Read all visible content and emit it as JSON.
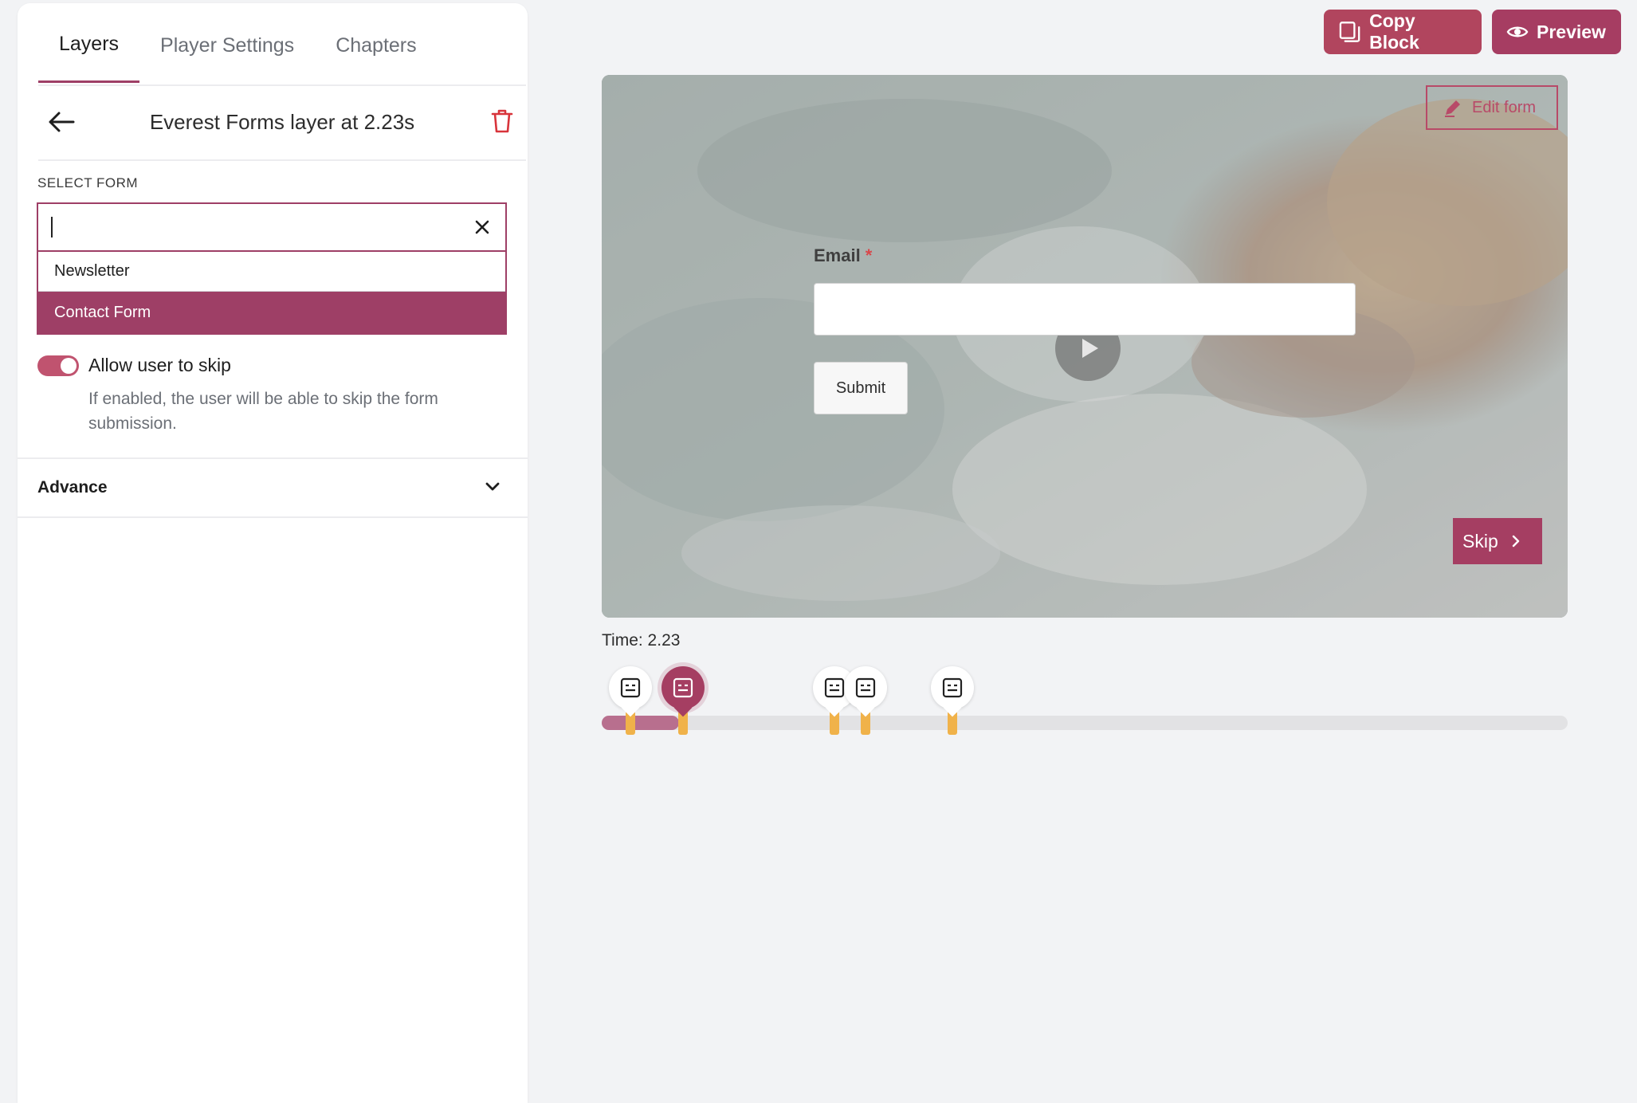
{
  "sidebar": {
    "tabs": [
      {
        "label": "Layers",
        "active": true
      },
      {
        "label": "Player Settings",
        "active": false
      },
      {
        "label": "Chapters",
        "active": false
      }
    ],
    "layer_title": "Everest Forms layer at 2.23s",
    "select_form": {
      "label": "SELECT FORM",
      "search_value": "",
      "options": [
        {
          "label": "Newsletter",
          "selected": false
        },
        {
          "label": "Contact Form",
          "selected": true
        }
      ]
    },
    "allow_skip": {
      "label": "Allow user to skip",
      "enabled": true,
      "help": "If enabled, the user will be able to skip the form submission."
    },
    "advance_label": "Advance"
  },
  "toolbar": {
    "copy_label": "Copy Block",
    "preview_label": "Preview"
  },
  "video": {
    "edit_form_label": "Edit form",
    "email_label": "Email",
    "required_mark": "*",
    "submit_label": "Submit",
    "skip_label": "Skip"
  },
  "timeline": {
    "time_text": "Time: 2.23",
    "progress_fraction": 0.08,
    "markers": [
      {
        "active": false
      },
      {
        "active": true
      },
      {
        "active": false
      },
      {
        "active": false
      },
      {
        "active": false
      }
    ]
  },
  "colors": {
    "accent": "#9e3f66",
    "tick": "#f0b24a",
    "danger": "#d8484b"
  }
}
